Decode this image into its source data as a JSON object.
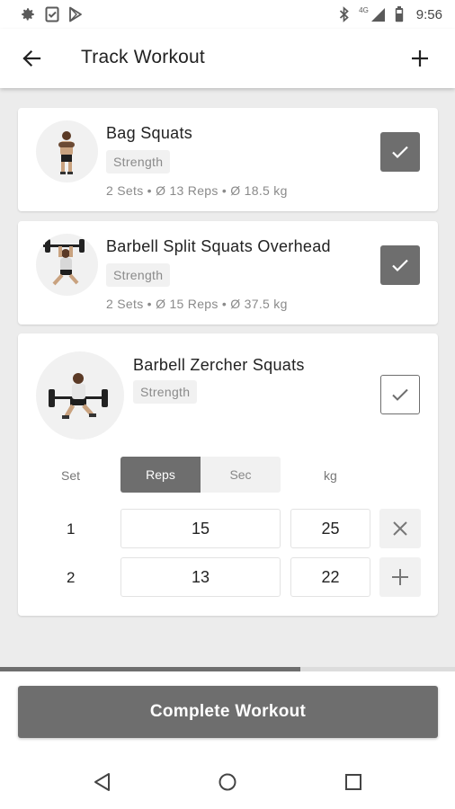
{
  "status_bar": {
    "time": "9:56",
    "network": "4G"
  },
  "app_bar": {
    "title": "Track Workout"
  },
  "exercises": [
    {
      "name": "Bag Squats",
      "category": "Strength",
      "summary": "2 Sets • Ø 13 Reps • Ø 18.5 kg",
      "completed": true
    },
    {
      "name": "Barbell Split Squats Overhead",
      "category": "Strength",
      "summary": "2 Sets • Ø 15 Reps • Ø 37.5 kg",
      "completed": true
    },
    {
      "name": "Barbell Zercher Squats",
      "category": "Strength",
      "completed": false,
      "columns": {
        "set": "Set",
        "reps": "Reps",
        "sec": "Sec",
        "kg": "kg"
      },
      "rows": [
        {
          "set": "1",
          "reps": "15",
          "kg": "25",
          "action": "close-icon"
        },
        {
          "set": "2",
          "reps": "13",
          "kg": "22",
          "action": "plus-icon"
        }
      ]
    }
  ],
  "progress": 0.66,
  "complete_button": "Complete Workout",
  "colors": {
    "accent": "#6e6e6e",
    "background": "#ececec",
    "tag_bg": "#f1f1f1"
  }
}
